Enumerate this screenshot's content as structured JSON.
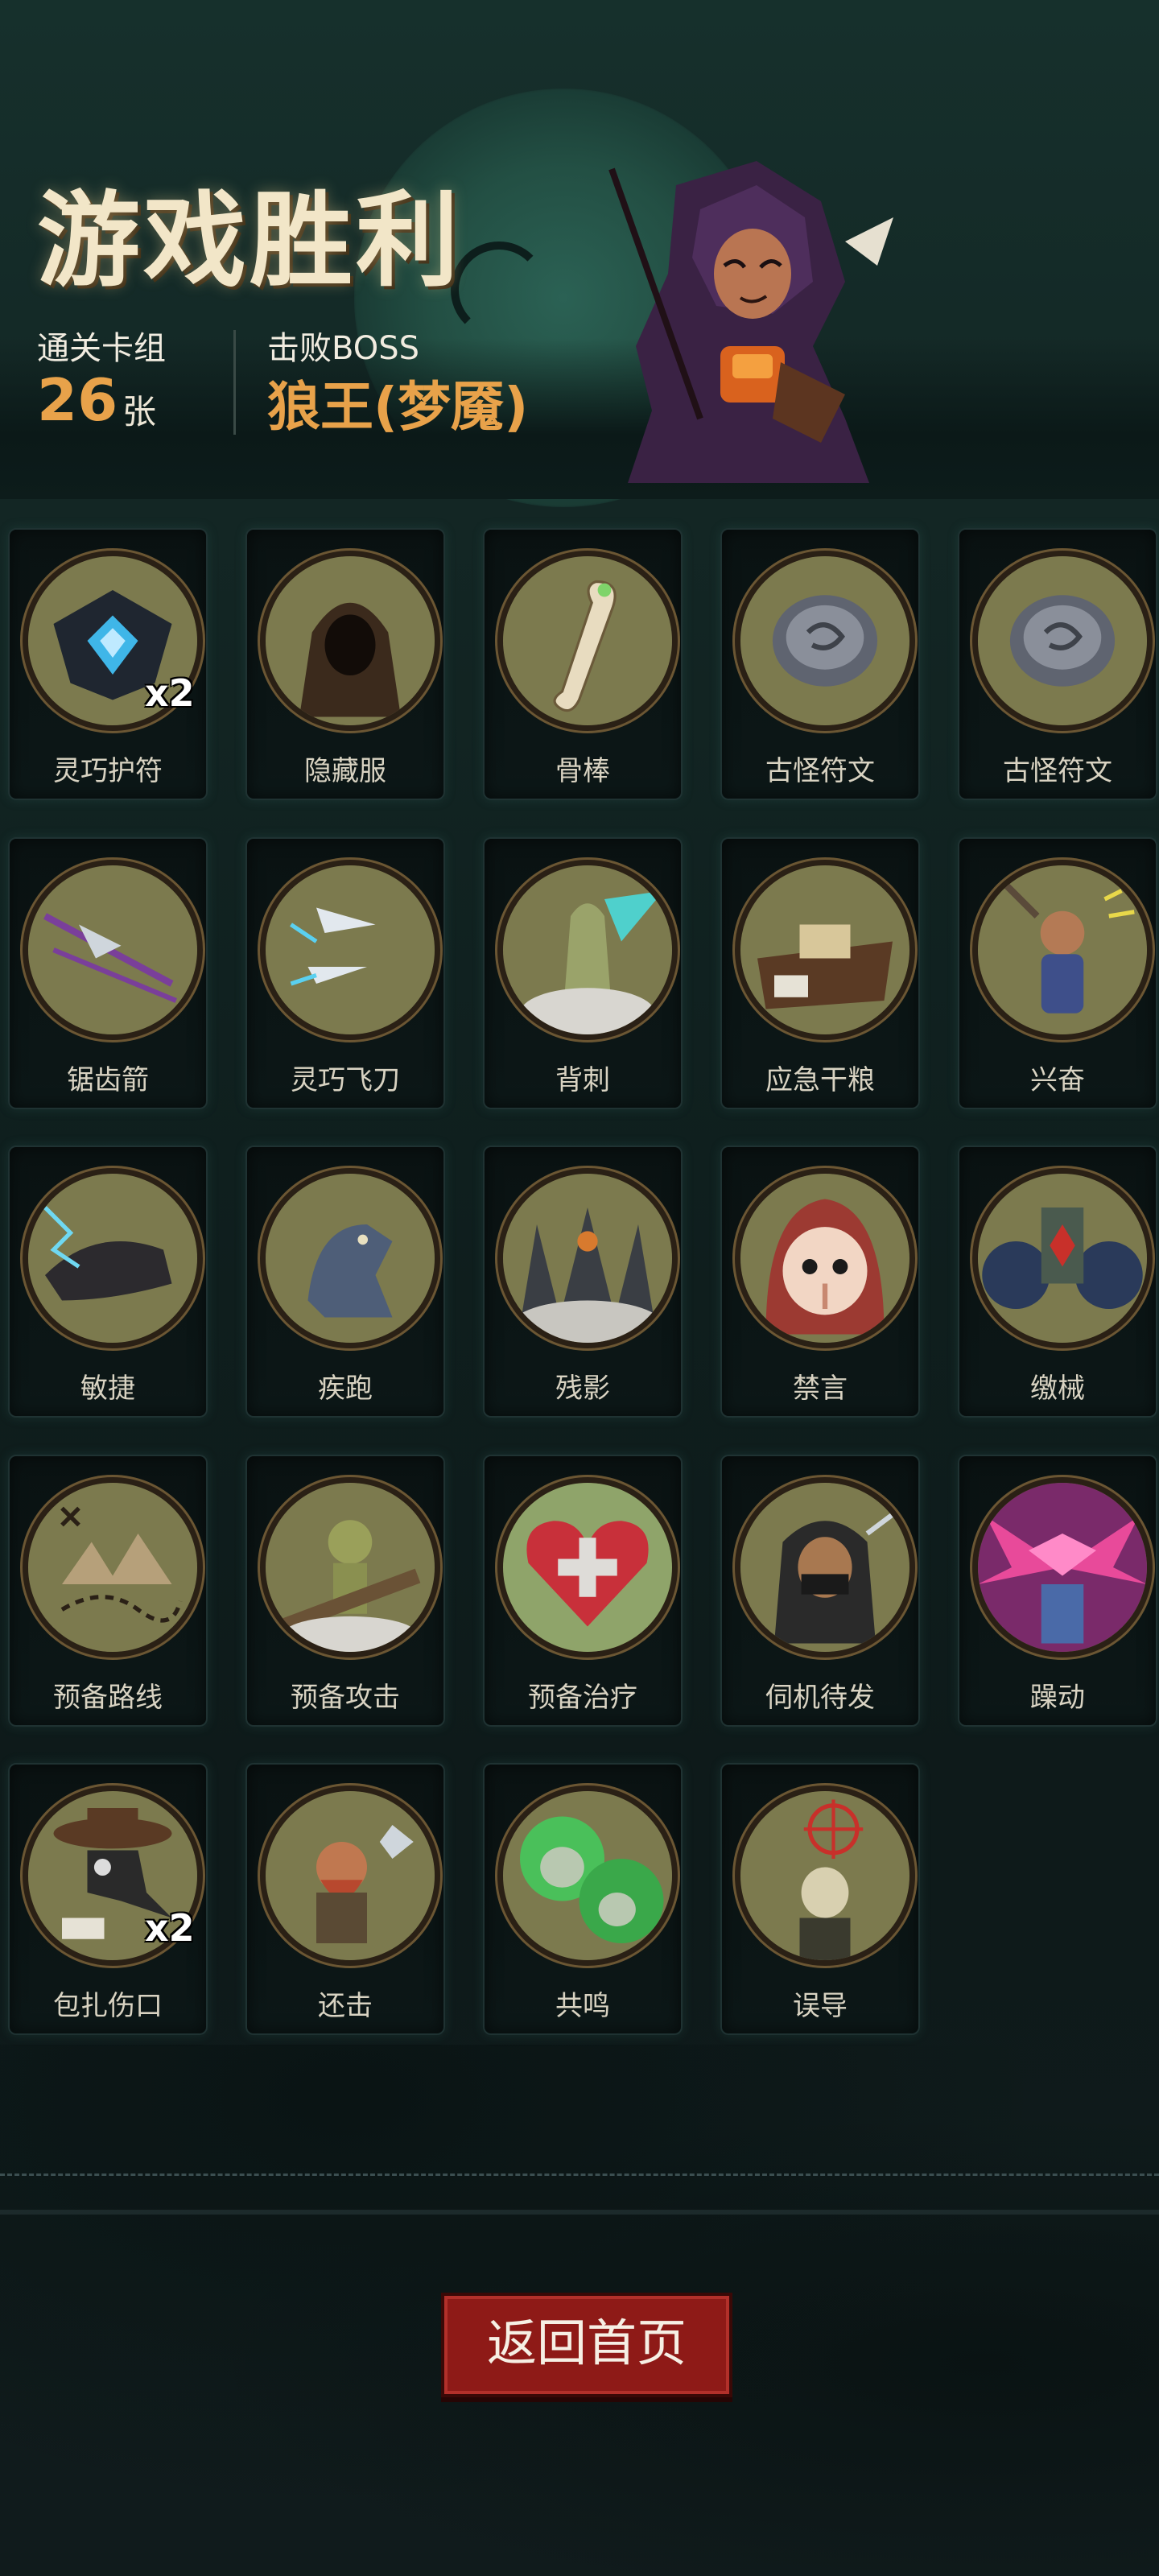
{
  "header": {
    "title": "游戏胜利",
    "cleared_deck_label": "通关卡组",
    "cleared_deck_count": "26",
    "cleared_deck_unit": "张",
    "boss_label": "击败BOSS",
    "boss_name": "狼王(梦魇)"
  },
  "cards": [
    {
      "name": "灵巧护符",
      "icon": "blue-charm-icon",
      "badge": "x2"
    },
    {
      "name": "隐藏服",
      "icon": "hooded-cloak-icon",
      "badge": ""
    },
    {
      "name": "骨棒",
      "icon": "bone-club-icon",
      "badge": ""
    },
    {
      "name": "古怪符文",
      "icon": "grey-rune-stone-icon",
      "badge": ""
    },
    {
      "name": "古怪符文",
      "icon": "grey-rune-stone-icon",
      "badge": ""
    },
    {
      "name": "锯齿箭",
      "icon": "serrated-arrow-icon",
      "badge": ""
    },
    {
      "name": "灵巧飞刀",
      "icon": "flying-knives-icon",
      "badge": ""
    },
    {
      "name": "背刺",
      "icon": "backstab-icon",
      "badge": ""
    },
    {
      "name": "应急干粮",
      "icon": "ration-bag-icon",
      "badge": ""
    },
    {
      "name": "兴奋",
      "icon": "excited-dwarf-icon",
      "badge": ""
    },
    {
      "name": "敏捷",
      "icon": "panther-icon",
      "badge": ""
    },
    {
      "name": "疾跑",
      "icon": "running-wolf-icon",
      "badge": ""
    },
    {
      "name": "残影",
      "icon": "afterimage-icon",
      "badge": ""
    },
    {
      "name": "禁言",
      "icon": "silence-hood-icon",
      "badge": ""
    },
    {
      "name": "缴械",
      "icon": "disarm-icon",
      "badge": ""
    },
    {
      "name": "预备路线",
      "icon": "treasure-map-icon",
      "badge": ""
    },
    {
      "name": "预备攻击",
      "icon": "goblin-strike-icon",
      "badge": ""
    },
    {
      "name": "预备治疗",
      "icon": "heart-cross-icon",
      "badge": ""
    },
    {
      "name": "伺机待发",
      "icon": "masked-rogue-icon",
      "badge": ""
    },
    {
      "name": "躁动",
      "icon": "frenzy-icon",
      "badge": ""
    },
    {
      "name": "包扎伤口",
      "icon": "plague-doctor-icon",
      "badge": "x2"
    },
    {
      "name": "还击",
      "icon": "counter-dwarf-icon",
      "badge": ""
    },
    {
      "name": "共鸣",
      "icon": "skull-swarm-icon",
      "badge": ""
    },
    {
      "name": "误导",
      "icon": "skeleton-target-icon",
      "badge": ""
    }
  ],
  "footer": {
    "return_label": "返回首页"
  },
  "colors": {
    "accent_orange": "#e8a24a",
    "button_red": "#8e1a17",
    "medallion_olive": "#7c7a4e"
  }
}
